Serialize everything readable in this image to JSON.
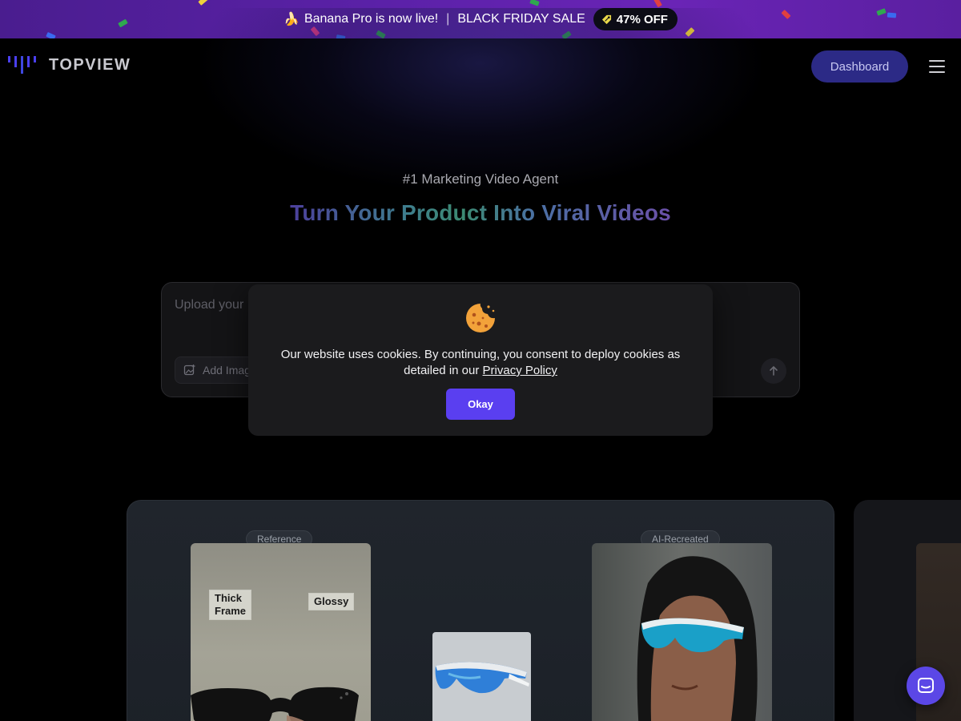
{
  "banner": {
    "emoji": "🍌",
    "announcement": "Banana Pro is now live!",
    "separator": "|",
    "sale": "BLACK FRIDAY SALE",
    "discount": "47% OFF",
    "discount_icon": "tag-icon"
  },
  "header": {
    "logo_text": "TOPVIEW",
    "dashboard_label": "Dashboard",
    "menu_icon": "hamburger-menu-icon"
  },
  "hero": {
    "eyebrow": "#1 Marketing Video Agent",
    "title": "Turn Your Product Into Viral Videos"
  },
  "prompt": {
    "placeholder": "Upload your",
    "add_image_label": "Add Imag",
    "send_icon": "arrow-up-icon"
  },
  "cookie": {
    "icon": "cookie-icon",
    "message": "Our website uses cookies. By continuing, you consent to deploy cookies as detailed in our ",
    "link_text": "Privacy Policy",
    "okay_label": "Okay"
  },
  "showcase": {
    "reference_label": "Reference",
    "ai_label": "AI-Recreated",
    "tag_thick": "Thick\nFrame",
    "tag_glossy": "Glossy"
  },
  "colors": {
    "banner": "#5b21a8",
    "accent": "#5a3ff0",
    "dashboard_bg": "#2c2a86",
    "chat_bg": "#5b47e6"
  }
}
